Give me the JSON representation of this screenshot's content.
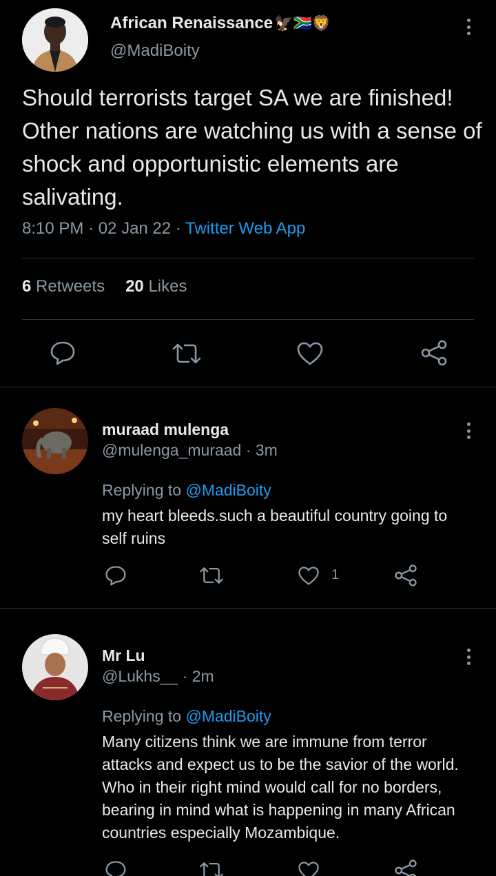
{
  "main_tweet": {
    "author_name": "African Renaissance",
    "author_emojis": "🦅🇿🇦🦁",
    "author_handle": "@MadiBoity",
    "text": "Should terrorists target SA we are finished! Other nations are watching us with a sense of shock and opportunistic elements are salivating.",
    "time": "8:10 PM · 02 Jan 22 · ",
    "source": "Twitter Web App",
    "retweets_count": "6",
    "retweets_label": "Retweets",
    "likes_count": "20",
    "likes_label": "Likes",
    "actions": [
      "reply-icon",
      "retweet-icon",
      "like-icon",
      "share-icon"
    ]
  },
  "replies": [
    {
      "name": "muraad mulenga",
      "handle": "@mulenga_muraad · 3m",
      "replying_prefix": "Replying to ",
      "replying_to": "@MadiBoity",
      "text": "my heart bleeds.such a beautiful country going to self ruins",
      "like_count": "1"
    },
    {
      "name": "Mr Lu",
      "handle": "@Lukhs__ · 2m",
      "replying_prefix": "Replying to ",
      "replying_to": "@MadiBoity",
      "text": "Many citizens think we are immune from terror attacks and expect us to be the savior of the world. Who in their right mind would call for no borders, bearing in mind what is happening in many African countries especially Mozambique."
    }
  ],
  "colors": {
    "background": "#000000",
    "text": "#e7e9ea",
    "secondary": "#8b98a5",
    "link": "#1d9bf0",
    "divider": "#2f3336"
  }
}
